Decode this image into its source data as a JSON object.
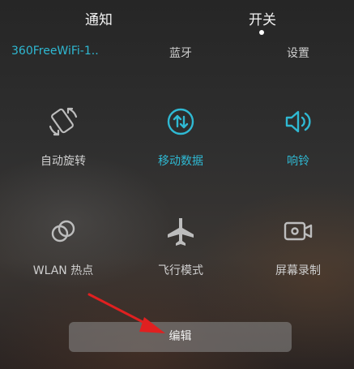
{
  "tabs": {
    "notify": "通知",
    "switch": "开关"
  },
  "top_row": {
    "wifi": "360FreeWiFi-1..",
    "bluetooth": "蓝牙",
    "settings": "设置"
  },
  "tiles": [
    {
      "label": "自动旋转",
      "icon": "rotate-icon",
      "active": false
    },
    {
      "label": "移动数据",
      "icon": "mobile-data-icon",
      "active": true
    },
    {
      "label": "响铃",
      "icon": "speaker-icon",
      "active": true
    },
    {
      "label": "WLAN 热点",
      "icon": "hotspot-icon",
      "active": false
    },
    {
      "label": "飞行模式",
      "icon": "airplane-icon",
      "active": false
    },
    {
      "label": "屏幕录制",
      "icon": "screen-record-icon",
      "active": false
    }
  ],
  "edit_button": "编辑",
  "colors": {
    "accent": "#2fb9d3",
    "inactive_icon": "#bdbdbd",
    "annotation_arrow": "#e02020"
  }
}
